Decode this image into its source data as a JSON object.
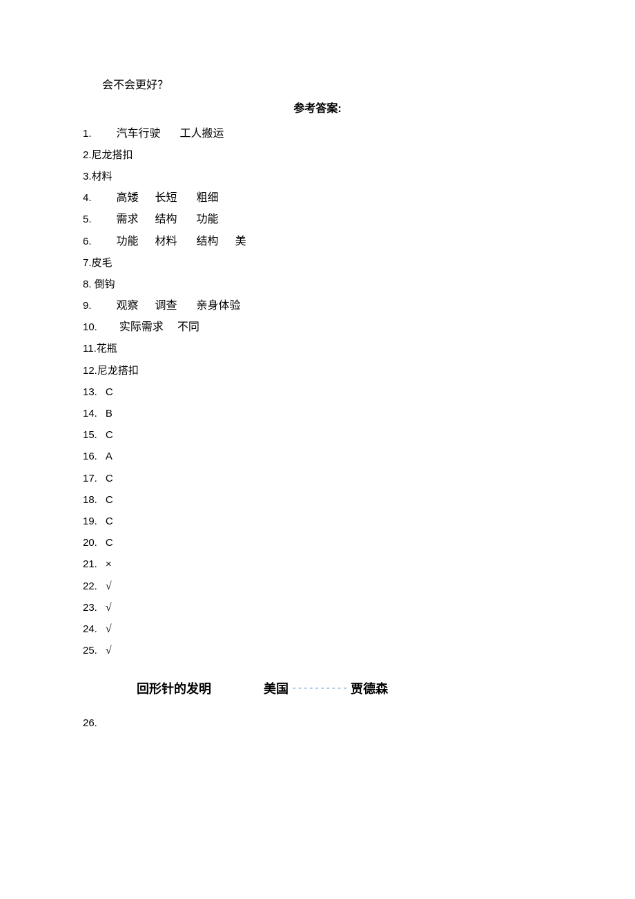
{
  "pretext": "会不会更好？",
  "header": "参考答案:",
  "answers": {
    "a1": {
      "num": "1.",
      "parts": [
        "汽车行驶",
        "工人搬运"
      ]
    },
    "a2": "2.尼龙搭扣",
    "a3": "3.材料",
    "a4": {
      "num": "4.",
      "parts": [
        "高矮",
        "长短",
        "粗细"
      ]
    },
    "a5": {
      "num": "5.",
      "parts": [
        "需求",
        "结构",
        "功能"
      ]
    },
    "a6": {
      "num": "6.",
      "parts": [
        "功能",
        "材料",
        "结构",
        "美"
      ]
    },
    "a7": "7.皮毛",
    "a8": "8. 倒钩",
    "a9": {
      "num": "9.",
      "parts": [
        "观察",
        "调查",
        "亲身体验"
      ]
    },
    "a10": {
      "num": "10.",
      "parts": [
        "实际需求",
        "不同"
      ]
    },
    "a11": "11.花瓶",
    "a12": "12.尼龙搭扣",
    "a13": {
      "num": "13.",
      "val": "C"
    },
    "a14": {
      "num": "14.",
      "val": "B"
    },
    "a15": {
      "num": "15.",
      "val": "C"
    },
    "a16": {
      "num": "16.",
      "val": "A"
    },
    "a17": {
      "num": "17.",
      "val": "C"
    },
    "a18": {
      "num": "18.",
      "val": "C"
    },
    "a19": {
      "num": "19.",
      "val": "C"
    },
    "a20": {
      "num": "20.",
      "val": "C"
    },
    "a21": {
      "num": "21.",
      "val": "×"
    },
    "a22": {
      "num": "22.",
      "val": "√"
    },
    "a23": {
      "num": "23.",
      "val": "√"
    },
    "a24": {
      "num": "24.",
      "val": "√"
    },
    "a25": {
      "num": "25.",
      "val": "√"
    },
    "a26": {
      "left": "回形针的发明",
      "mid": "美国",
      "dashes": "- - - - - - - - - -",
      "right": "贾德森",
      "num": "26."
    }
  }
}
